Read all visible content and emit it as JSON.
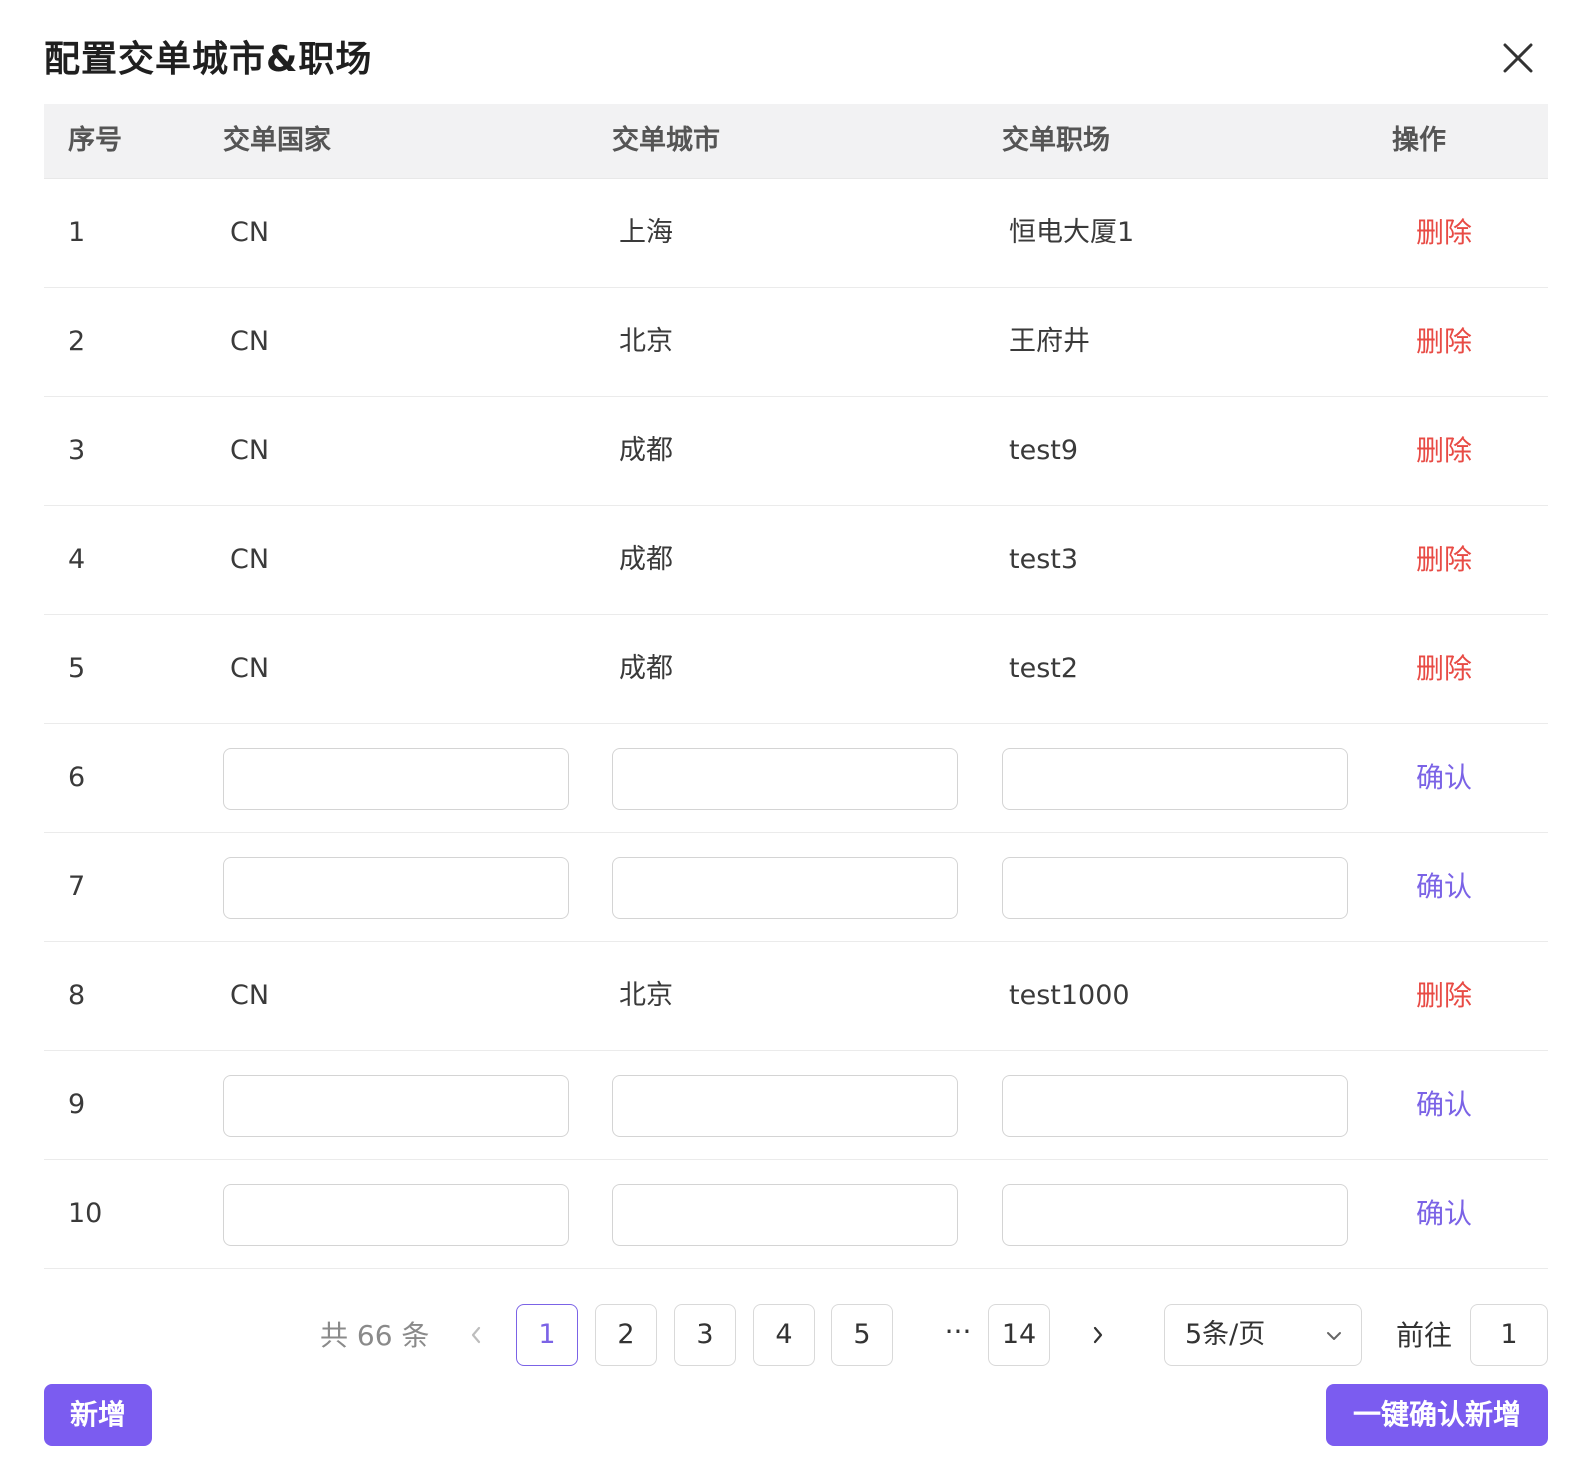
{
  "dialog": {
    "title": "配置交单城市&职场"
  },
  "table": {
    "columns": [
      "序号",
      "交单国家",
      "交单城市",
      "交单职场",
      "操作"
    ],
    "rows": [
      {
        "index": "1",
        "country": "CN",
        "city": "上海",
        "office": "恒电大厦1",
        "action": "删除",
        "editing": false
      },
      {
        "index": "2",
        "country": "CN",
        "city": "北京",
        "office": "王府井",
        "action": "删除",
        "editing": false
      },
      {
        "index": "3",
        "country": "CN",
        "city": "成都",
        "office": "test9",
        "action": "删除",
        "editing": false
      },
      {
        "index": "4",
        "country": "CN",
        "city": "成都",
        "office": "test3",
        "action": "删除",
        "editing": false
      },
      {
        "index": "5",
        "country": "CN",
        "city": "成都",
        "office": "test2",
        "action": "删除",
        "editing": false
      },
      {
        "index": "6",
        "country": "",
        "city": "",
        "office": "",
        "action": "确认",
        "editing": true
      },
      {
        "index": "7",
        "country": "",
        "city": "",
        "office": "",
        "action": "确认",
        "editing": true
      },
      {
        "index": "8",
        "country": "CN",
        "city": "北京",
        "office": "test1000",
        "action": "删除",
        "editing": false
      },
      {
        "index": "9",
        "country": "",
        "city": "",
        "office": "",
        "action": "确认",
        "editing": true
      },
      {
        "index": "10",
        "country": "",
        "city": "",
        "office": "",
        "action": "确认",
        "editing": true
      }
    ]
  },
  "pagination": {
    "total_text": "共 66 条",
    "pages": [
      "1",
      "2",
      "3",
      "4",
      "5"
    ],
    "current_page": "1",
    "ellipsis": "···",
    "last_page": "14",
    "page_size": "5条/页",
    "goto_label": "前往",
    "goto_value": "1"
  },
  "footer": {
    "add_label": "新增",
    "batch_confirm_label": "一键确认新增"
  },
  "colors": {
    "primary": "#7b5cf0",
    "link_confirm": "#7b63e6",
    "link_delete": "#e84b45",
    "header_bg": "#f2f2f3"
  },
  "icons": {
    "close": "close-icon",
    "prev": "chevron-left-icon",
    "next": "chevron-right-icon",
    "select": "chevron-down-icon"
  }
}
